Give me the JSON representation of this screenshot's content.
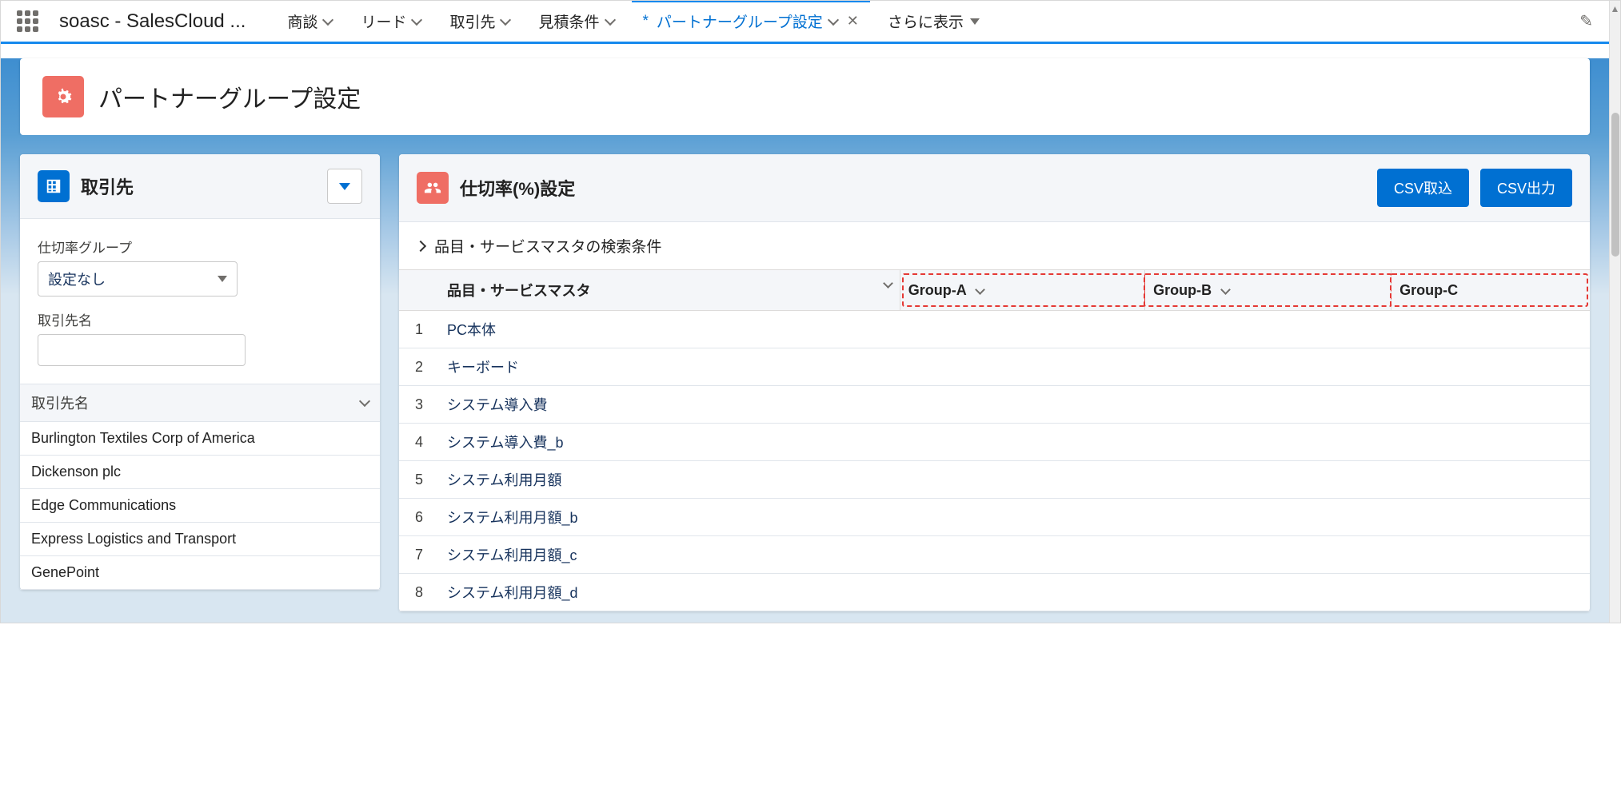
{
  "topbar": {
    "app_name": "soasc - SalesCloud ...",
    "nav": [
      {
        "label": "商談"
      },
      {
        "label": "リード"
      },
      {
        "label": "取引先"
      },
      {
        "label": "見積条件"
      },
      {
        "label": "パートナーグループ設定",
        "active": true
      },
      {
        "label": "さらに表示"
      }
    ]
  },
  "page": {
    "title": "パートナーグループ設定"
  },
  "sidebar": {
    "title": "取引先",
    "group_label": "仕切率グループ",
    "group_value": "設定なし",
    "name_label": "取引先名",
    "list_header": "取引先名",
    "accounts": [
      "Burlington Textiles Corp of America",
      "Dickenson plc",
      "Edge Communications",
      "Express Logistics and Transport",
      "GenePoint"
    ]
  },
  "main": {
    "title": "仕切率(%)設定",
    "btn_import": "CSV取込",
    "btn_export": "CSV出力",
    "search_cond": "品目・サービスマスタの検索条件",
    "col_product": "品目・サービスマスタ",
    "group_cols": [
      "Group-A",
      "Group-B",
      "Group-C"
    ],
    "rows": [
      {
        "n": "1",
        "name": "PC本体"
      },
      {
        "n": "2",
        "name": "キーボード"
      },
      {
        "n": "3",
        "name": "システム導入費"
      },
      {
        "n": "4",
        "name": "システム導入費_b"
      },
      {
        "n": "5",
        "name": "システム利用月額"
      },
      {
        "n": "6",
        "name": "システム利用月額_b"
      },
      {
        "n": "7",
        "name": "システム利用月額_c"
      },
      {
        "n": "8",
        "name": "システム利用月額_d"
      }
    ]
  }
}
